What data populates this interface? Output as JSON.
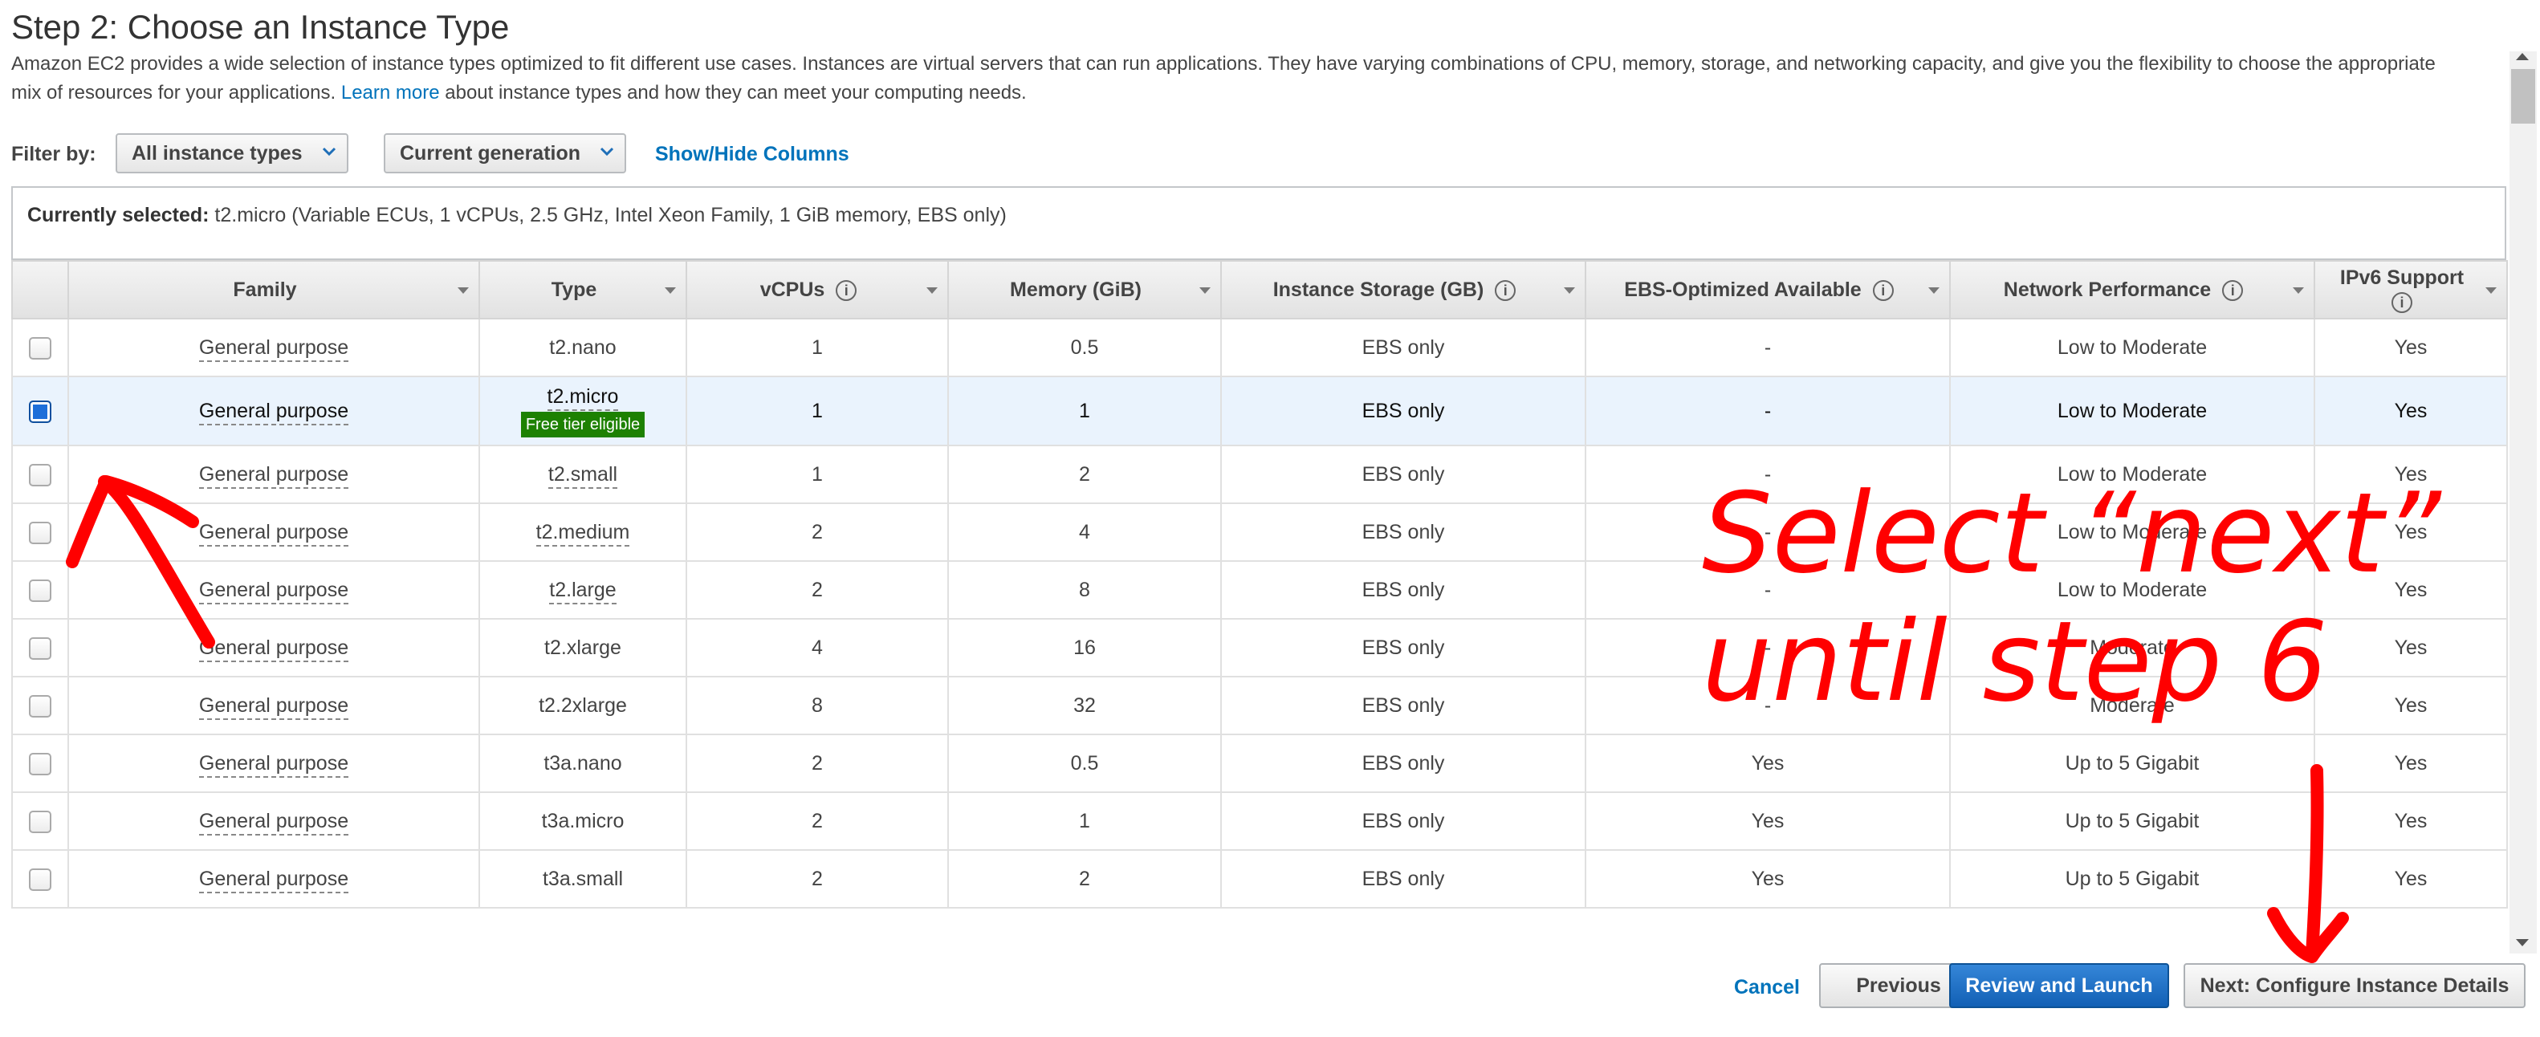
{
  "page": {
    "title": "Step 2: Choose an Instance Type",
    "description_part1": "Amazon EC2 provides a wide selection of instance types optimized to fit different use cases. Instances are virtual servers that can run applications. They have varying combinations of CPU, memory, storage, and networking capacity, and give you the flexibility to choose the appropriate mix of resources for your applications.",
    "learn_more": "Learn more",
    "description_part2": "about instance types and how they can meet your computing needs."
  },
  "filter": {
    "label": "Filter by:",
    "instance_types_value": "All instance types",
    "generation_value": "Current generation",
    "show_hide_columns": "Show/Hide Columns"
  },
  "currently_selected": {
    "label": "Currently selected:",
    "value": "t2.micro (Variable ECUs, 1 vCPUs, 2.5 GHz, Intel Xeon Family, 1 GiB memory, EBS only)"
  },
  "table": {
    "headers": [
      "Family",
      "Type",
      "vCPUs",
      "Memory (GiB)",
      "Instance Storage (GB)",
      "EBS-Optimized Available",
      "Network Performance",
      "IPv6 Support"
    ],
    "free_tier_badge": "Free tier eligible",
    "rows": [
      {
        "family": "General purpose",
        "type": "t2.nano",
        "vcpus": "1",
        "memory": "0.5",
        "storage": "EBS only",
        "ebs_opt": "-",
        "network": "Low to Moderate",
        "ipv6": "Yes",
        "selected": false
      },
      {
        "family": "General purpose",
        "type": "t2.micro",
        "vcpus": "1",
        "memory": "1",
        "storage": "EBS only",
        "ebs_opt": "-",
        "network": "Low to Moderate",
        "ipv6": "Yes",
        "selected": true
      },
      {
        "family": "General purpose",
        "type": "t2.small",
        "vcpus": "1",
        "memory": "2",
        "storage": "EBS only",
        "ebs_opt": "-",
        "network": "Low to Moderate",
        "ipv6": "Yes",
        "selected": false
      },
      {
        "family": "General purpose",
        "type": "t2.medium",
        "vcpus": "2",
        "memory": "4",
        "storage": "EBS only",
        "ebs_opt": "-",
        "network": "Low to Moderate",
        "ipv6": "Yes",
        "selected": false
      },
      {
        "family": "General purpose",
        "type": "t2.large",
        "vcpus": "2",
        "memory": "8",
        "storage": "EBS only",
        "ebs_opt": "-",
        "network": "Low to Moderate",
        "ipv6": "Yes",
        "selected": false
      },
      {
        "family": "General purpose",
        "type": "t2.xlarge",
        "vcpus": "4",
        "memory": "16",
        "storage": "EBS only",
        "ebs_opt": "-",
        "network": "Moderate",
        "ipv6": "Yes",
        "selected": false
      },
      {
        "family": "General purpose",
        "type": "t2.2xlarge",
        "vcpus": "8",
        "memory": "32",
        "storage": "EBS only",
        "ebs_opt": "-",
        "network": "Moderate",
        "ipv6": "Yes",
        "selected": false
      },
      {
        "family": "General purpose",
        "type": "t3a.nano",
        "vcpus": "2",
        "memory": "0.5",
        "storage": "EBS only",
        "ebs_opt": "Yes",
        "network": "Up to 5 Gigabit",
        "ipv6": "Yes",
        "selected": false
      },
      {
        "family": "General purpose",
        "type": "t3a.micro",
        "vcpus": "2",
        "memory": "1",
        "storage": "EBS only",
        "ebs_opt": "Yes",
        "network": "Up to 5 Gigabit",
        "ipv6": "Yes",
        "selected": false
      },
      {
        "family": "General purpose",
        "type": "t3a.small",
        "vcpus": "2",
        "memory": "2",
        "storage": "EBS only",
        "ebs_opt": "Yes",
        "network": "Up to 5 Gigabit",
        "ipv6": "Yes",
        "selected": false
      }
    ]
  },
  "footer": {
    "cancel": "Cancel",
    "previous": "Previous",
    "review_launch": "Review and Launch",
    "next": "Next: Configure Instance Details"
  },
  "annotation": {
    "line1": "Select “next”",
    "line2": "until step 6",
    "color": "#ff0000"
  },
  "colors": {
    "link": "#0073bb",
    "primary_button": "#1a6fc9",
    "free_tier_badge": "#1d8102",
    "selected_row": "#eaf3fd"
  },
  "icons": [
    "info-icon",
    "chevron-down-icon",
    "sort-caret-icon",
    "checkbox-icon"
  ]
}
